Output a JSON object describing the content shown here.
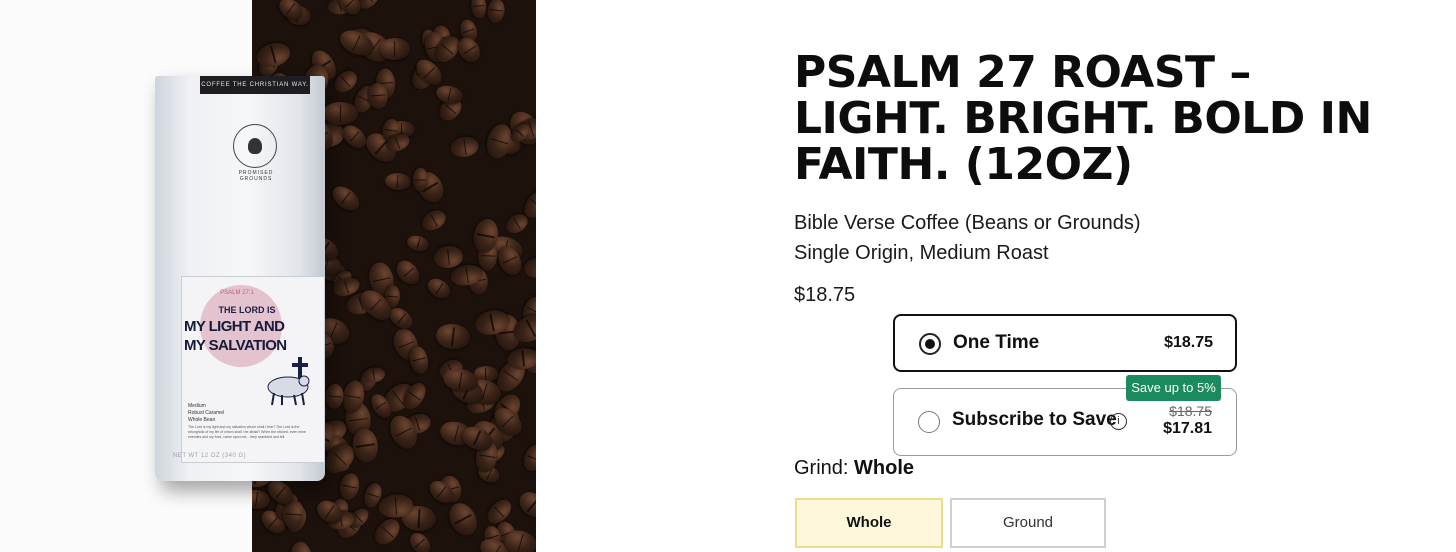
{
  "product": {
    "title": "PSALM 27 ROAST – LIGHT. BRIGHT. BOLD IN FAITH. (12OZ)",
    "subtitle_1": "Bible Verse Coffee (Beans or Grounds)",
    "subtitle_2": "Single Origin, Medium Roast",
    "price": "$18.75"
  },
  "bag": {
    "band_text": "COFFEE THE CHRISTIAN WAY.",
    "logo_text": "PROMISED GROUNDS",
    "label_small": "PSALM 27:1",
    "label_line1": "THE LORD IS",
    "label_line2": "MY LIGHT AND",
    "label_line3": "MY SALVATION",
    "info_1": "Medium",
    "info_2": "Robust Caramel",
    "info_3": "Whole Bean",
    "fine_print": "The Lord is my light and my salvation whom shall I fear? The Lord is the stronghold of my life of whom shall I be afraid? When the wicked, even mine enemies and my foes, came upon me... they stumbled and fell.",
    "weight": "NET WT 12 OZ (340 G)"
  },
  "purchase": {
    "one_time_label": "One Time",
    "one_time_price": "$18.75",
    "subscribe_label": "Subscribe to Save",
    "subscribe_old_price": "$18.75",
    "subscribe_price": "$17.81",
    "save_badge": "Save up to 5%",
    "info_symbol": "i",
    "selected": "one_time"
  },
  "grind": {
    "label": "Grind:",
    "selected_value": "Whole",
    "options": [
      "Whole",
      "Ground"
    ]
  },
  "icons": {
    "info": "info-circle-icon",
    "radio": "radio-button-icon"
  },
  "colors": {
    "badge_green": "#1b8a5f",
    "selected_grind_bg": "#fdf8dc",
    "selected_grind_border": "#ecdc8c"
  }
}
